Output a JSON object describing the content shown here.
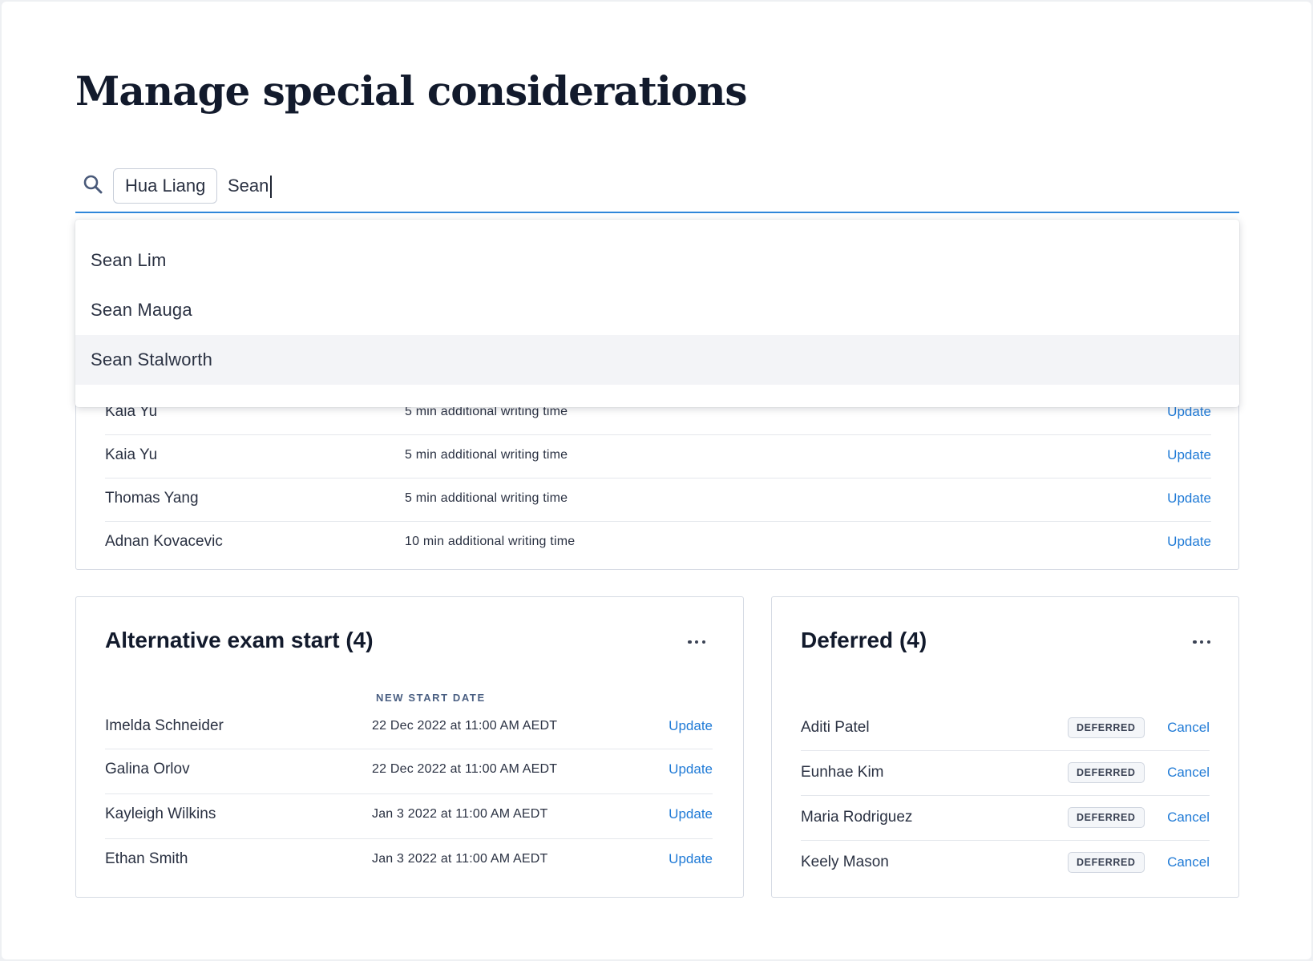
{
  "page": {
    "title": "Manage special considerations"
  },
  "search": {
    "selected_chip": "Hua Liang",
    "query": "Sean",
    "suggestions": [
      "Sean Lim",
      "Sean Mauga",
      "Sean Stalworth"
    ],
    "highlighted_index": 2
  },
  "extra_time": {
    "rows": [
      {
        "name": "Kaia Yu",
        "detail": "5 min additional writing time",
        "action": "Update"
      },
      {
        "name": "Thomas Yang",
        "detail": "5 min additional writing time",
        "action": "Update"
      },
      {
        "name": "Adnan Kovacevic",
        "detail": "10 min additional writing time",
        "action": "Update"
      }
    ]
  },
  "alternative_start": {
    "title": "Alternative exam start (4)",
    "column_header": "NEW START DATE",
    "rows": [
      {
        "name": "Imelda Schneider",
        "date": "22 Dec 2022 at 11:00 AM AEDT",
        "action": "Update"
      },
      {
        "name": "Galina Orlov",
        "date": "22 Dec 2022 at 11:00 AM AEDT",
        "action": "Update"
      },
      {
        "name": "Kayleigh Wilkins",
        "date": "Jan 3 2022 at 11:00 AM AEDT",
        "action": "Update"
      },
      {
        "name": "Ethan Smith",
        "date": "Jan 3 2022 at 11:00 AM AEDT",
        "action": "Update"
      }
    ]
  },
  "deferred": {
    "title": "Deferred (4)",
    "rows": [
      {
        "name": "Aditi Patel",
        "status": "DEFERRED",
        "action": "Cancel"
      },
      {
        "name": "Eunhae Kim",
        "status": "DEFERRED",
        "action": "Cancel"
      },
      {
        "name": "Maria Rodriguez",
        "status": "DEFERRED",
        "action": "Cancel"
      },
      {
        "name": "Keely Mason",
        "status": "DEFERRED",
        "action": "Cancel"
      }
    ]
  },
  "colors": {
    "accent": "#1f7ad6",
    "title": "#121a2c",
    "border": "#d6dbe4"
  }
}
